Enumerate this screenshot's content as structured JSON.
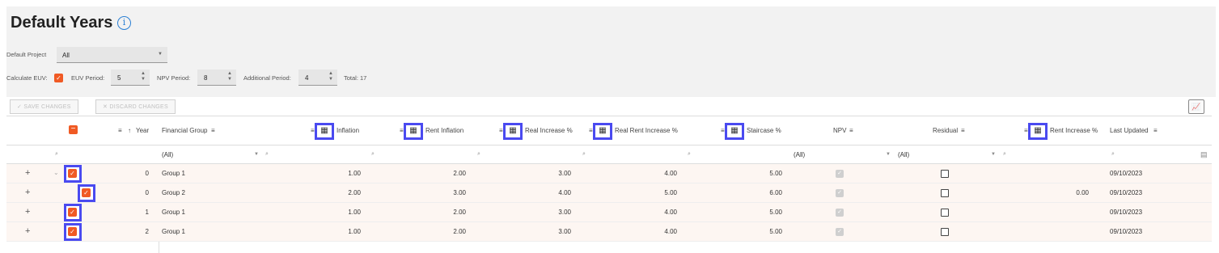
{
  "page": {
    "title": "Default Years",
    "info_icon": "info-icon"
  },
  "controls": {
    "default_project_label": "Default Project",
    "default_project_value": "All",
    "calculate_euv_label": "Calculate EUV:",
    "euv_period_label": "EUV Period:",
    "euv_period_value": "5",
    "npv_period_label": "NPV Period:",
    "npv_period_value": "8",
    "additional_period_label": "Additional Period:",
    "additional_period_value": "4",
    "total_text": "Total: 17"
  },
  "toolbar": {
    "save_label": "SAVE CHANGES",
    "discard_label": "DISCARD CHANGES",
    "chart_icon": "chart-icon"
  },
  "grid": {
    "headers": {
      "year": "Year",
      "financial_group": "Financial Group",
      "inflation": "Inflation",
      "rent_inflation": "Rent Inflation",
      "real_increase": "Real Increase %",
      "real_rent_increase": "Real Rent Increase %",
      "staircase": "Staircase %",
      "npv": "NPV",
      "residual": "Residual",
      "rent_increase": "Rent Increase %",
      "last_updated": "Last Updated"
    },
    "filters": {
      "financial_group": "(All)",
      "npv": "(All)",
      "residual": "(All)"
    },
    "rows": [
      {
        "expand": "+",
        "year": "0",
        "group": "Group 1",
        "inflation": "1.00",
        "rent_inflation": "2.00",
        "real_increase": "3.00",
        "real_rent_increase": "4.00",
        "staircase": "5.00",
        "rent_increase": "",
        "last_updated": "09/10/2023"
      },
      {
        "expand": "+",
        "year": "0",
        "group": "Group 2",
        "inflation": "2.00",
        "rent_inflation": "3.00",
        "real_increase": "4.00",
        "real_rent_increase": "5.00",
        "staircase": "6.00",
        "rent_increase": "0.00",
        "last_updated": "09/10/2023"
      },
      {
        "expand": "+",
        "year": "1",
        "group": "Group 1",
        "inflation": "1.00",
        "rent_inflation": "2.00",
        "real_increase": "3.00",
        "real_rent_increase": "4.00",
        "staircase": "5.00",
        "rent_increase": "",
        "last_updated": "09/10/2023"
      },
      {
        "expand": "+",
        "year": "2",
        "group": "Group 1",
        "inflation": "1.00",
        "rent_inflation": "2.00",
        "real_increase": "3.00",
        "real_rent_increase": "4.00",
        "staircase": "5.00",
        "rent_increase": "",
        "last_updated": "09/10/2023"
      }
    ]
  },
  "colors": {
    "accent": "#f05a24",
    "highlight_border": "#4a4af0",
    "info": "#2a7fd4"
  }
}
